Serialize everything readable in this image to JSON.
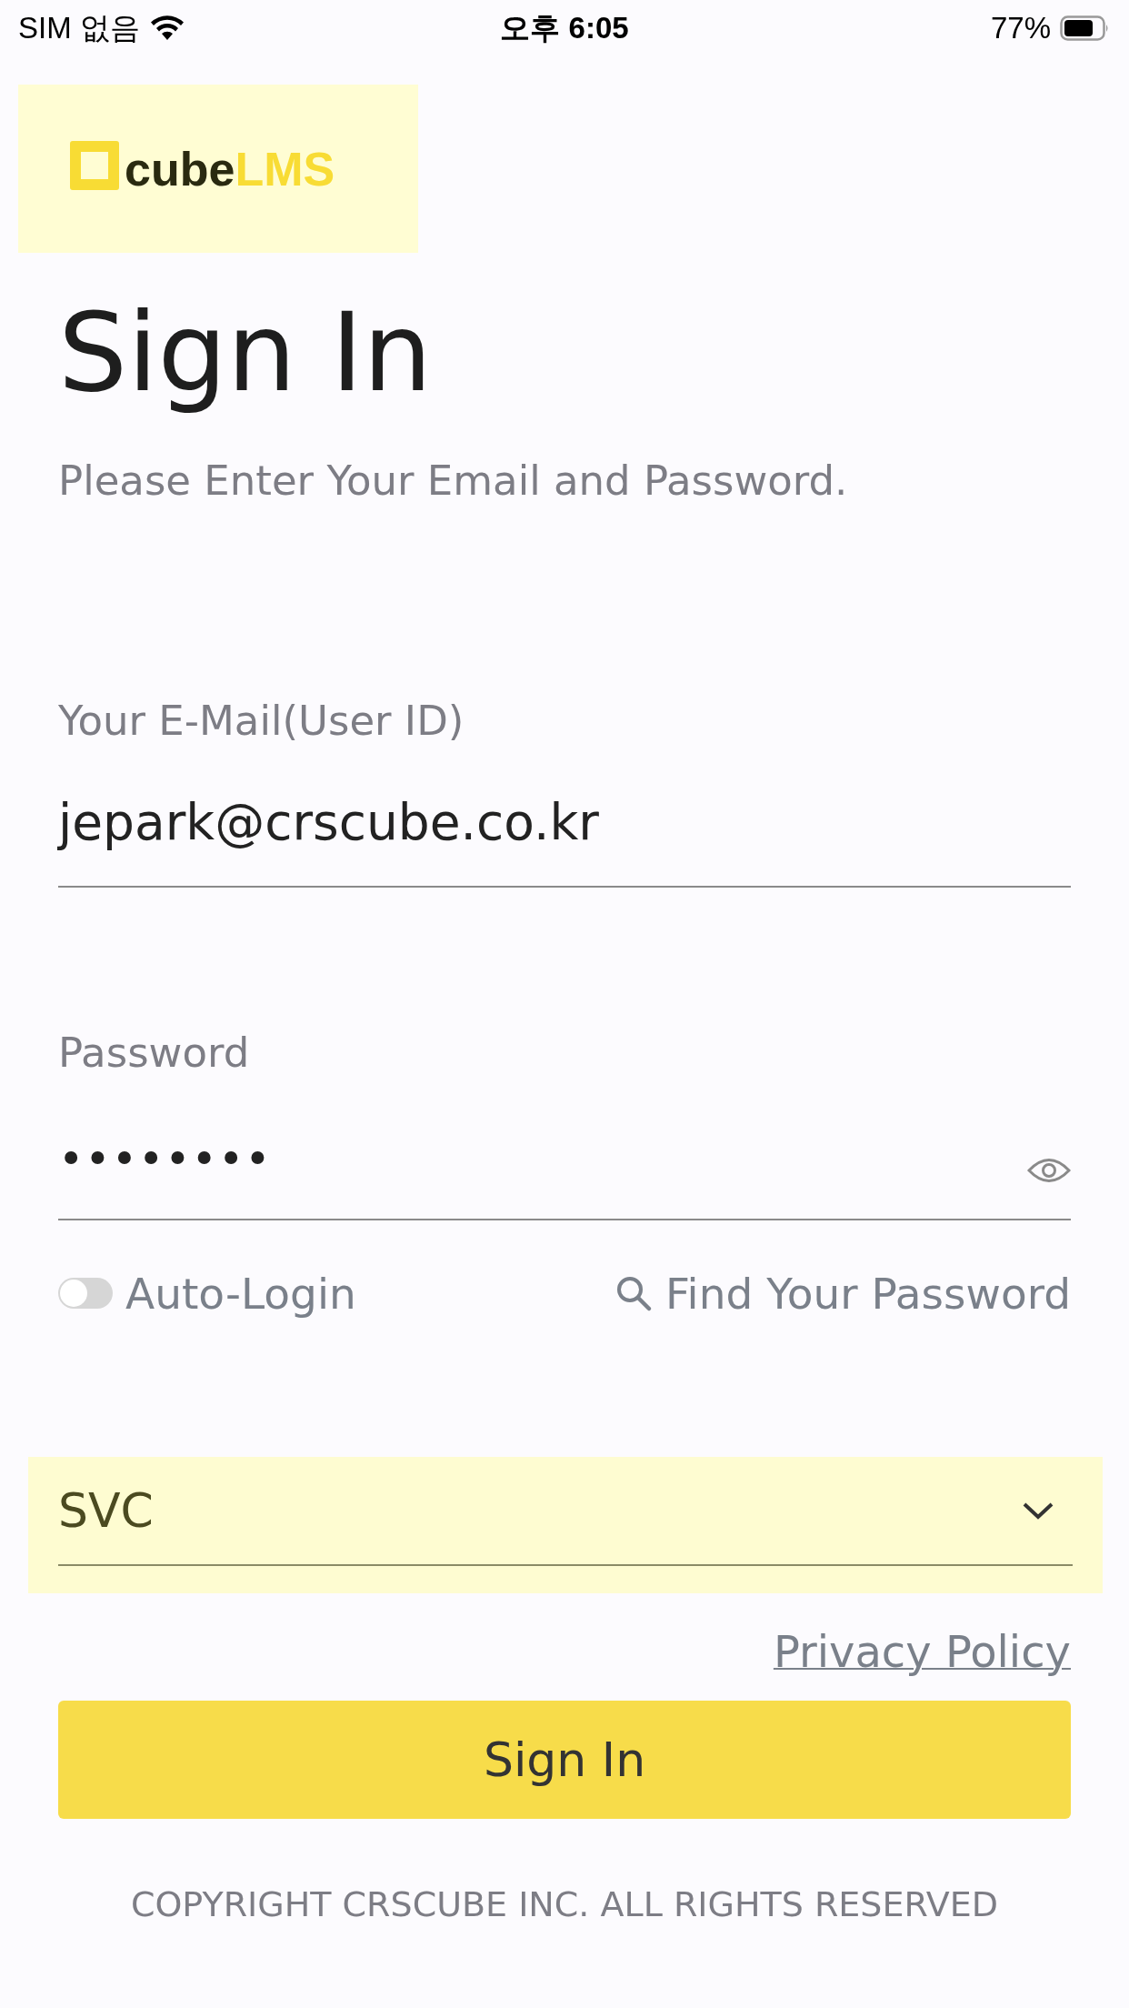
{
  "status_bar": {
    "carrier": "SIM 없음",
    "time": "오후 6:05",
    "battery": "77%"
  },
  "logo": {
    "word": "cube",
    "accent": "LMS"
  },
  "title": "Sign In",
  "subtitle": "Please Enter Your Email and Password.",
  "email": {
    "label": "Your E-Mail(User ID)",
    "value": "jepark@crscube.co.kr"
  },
  "password": {
    "label": "Password",
    "value": "••••••••"
  },
  "auto_login": {
    "label": "Auto-Login",
    "on": false
  },
  "find_password": "Find Your Password",
  "server": {
    "value": "SVC"
  },
  "privacy_policy": "Privacy Policy",
  "sign_in_button": "Sign In",
  "copyright": "COPYRIGHT CRSCUBE INC. ALL RIGHTS RESERVED"
}
